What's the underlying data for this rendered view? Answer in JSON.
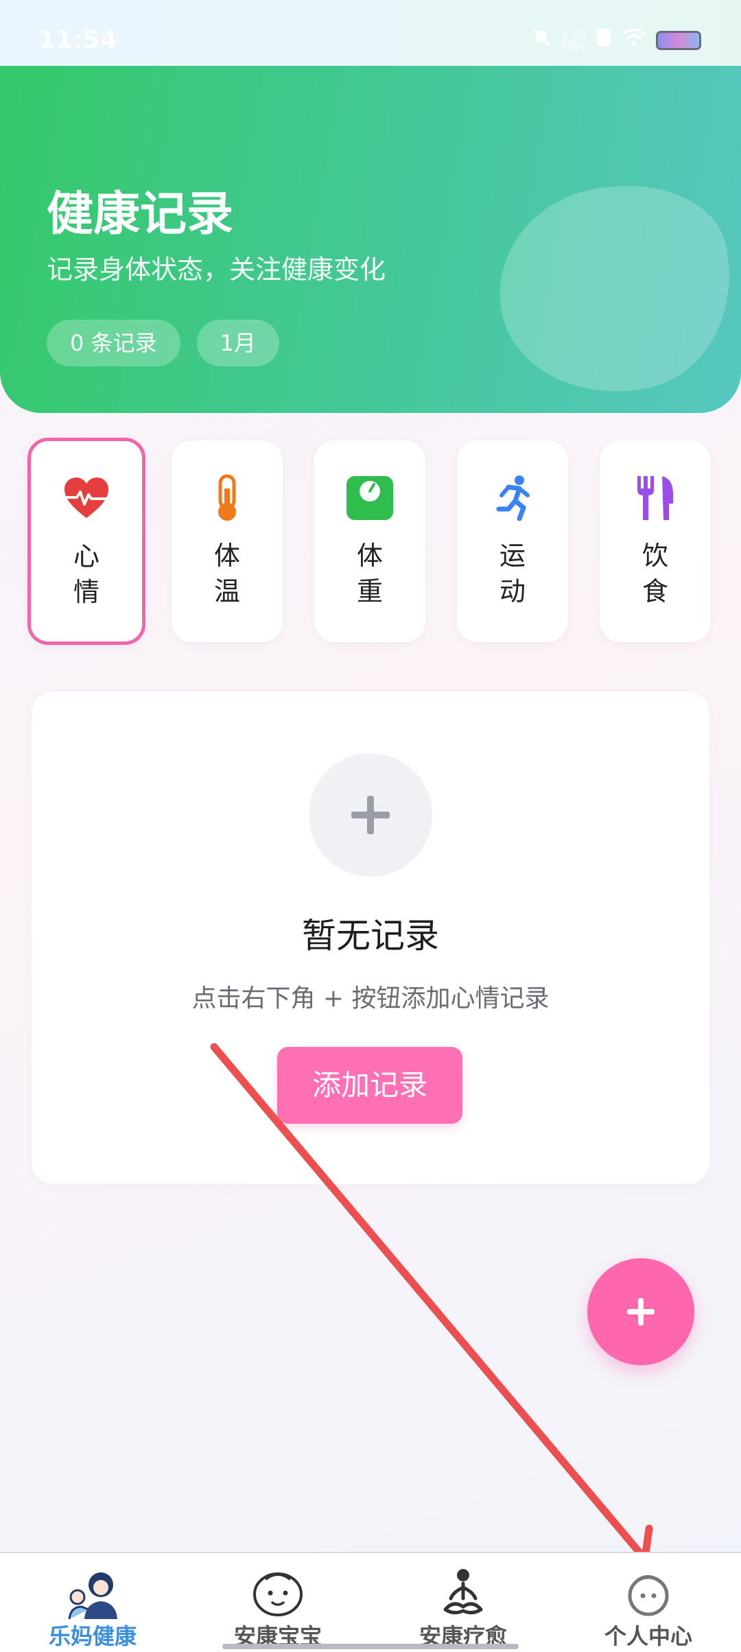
{
  "status_bar": {
    "time": "11:54",
    "speed_value": "1.70",
    "speed_unit": "KB/s"
  },
  "hero": {
    "title": "健康记录",
    "subtitle": "记录身体状态，关注健康变化",
    "chips": [
      "0 条记录",
      "1月"
    ]
  },
  "categories": [
    {
      "label": "心情",
      "icon": "heart-pulse-icon",
      "color": "#e53e3e",
      "active": true
    },
    {
      "label": "体温",
      "icon": "thermometer-icon",
      "color": "#f07a1a",
      "active": false
    },
    {
      "label": "体重",
      "icon": "scale-icon",
      "color": "#2fbd4e",
      "active": false
    },
    {
      "label": "运动",
      "icon": "running-icon",
      "color": "#3b82f6",
      "active": false
    },
    {
      "label": "饮食",
      "icon": "utensils-icon",
      "color": "#9b4de8",
      "active": false
    }
  ],
  "empty_state": {
    "title": "暂无记录",
    "description": "点击右下角 + 按钮添加心情记录",
    "button_label": "添加记录"
  },
  "bottom_nav": [
    {
      "label": "乐妈健康",
      "icon": "mother-baby-icon",
      "active": true
    },
    {
      "label": "安康宝宝",
      "icon": "baby-face-icon",
      "active": false
    },
    {
      "label": "安康疗愈",
      "icon": "meditation-icon",
      "active": false
    },
    {
      "label": "个人中心",
      "icon": "profile-icon",
      "active": false
    }
  ],
  "colors": {
    "accent_pink": "#ff6fb4",
    "hero_green": "#35c96a",
    "nav_active": "#3a8fe0",
    "annotation_arrow": "#ec4f4f"
  }
}
